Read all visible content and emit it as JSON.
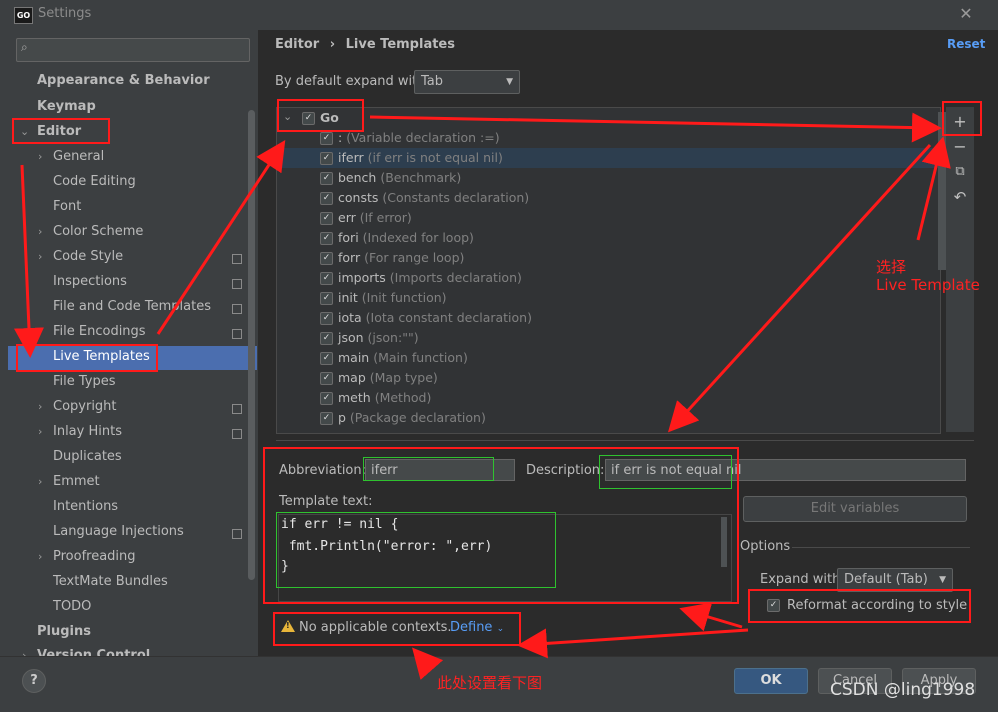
{
  "window": {
    "title": "Settings",
    "logo": "GO"
  },
  "sidebar": {
    "search_placeholder": "",
    "items": [
      {
        "label": "Appearance & Behavior"
      },
      {
        "label": "Keymap"
      },
      {
        "label": "Editor"
      },
      {
        "label": "General"
      },
      {
        "label": "Code Editing"
      },
      {
        "label": "Font"
      },
      {
        "label": "Color Scheme"
      },
      {
        "label": "Code Style"
      },
      {
        "label": "Inspections"
      },
      {
        "label": "File and Code Templates"
      },
      {
        "label": "File Encodings"
      },
      {
        "label": "Live Templates"
      },
      {
        "label": "File Types"
      },
      {
        "label": "Copyright"
      },
      {
        "label": "Inlay Hints"
      },
      {
        "label": "Duplicates"
      },
      {
        "label": "Emmet"
      },
      {
        "label": "Intentions"
      },
      {
        "label": "Language Injections"
      },
      {
        "label": "Proofreading"
      },
      {
        "label": "TextMate Bundles"
      },
      {
        "label": "TODO"
      },
      {
        "label": "Plugins"
      },
      {
        "label": "Version Control"
      }
    ]
  },
  "header": {
    "crumb_parent": "Editor",
    "crumb_sep": "›",
    "crumb_current": "Live Templates",
    "reset": "Reset"
  },
  "expand": {
    "label": "By default expand with",
    "value": "Tab"
  },
  "group": {
    "name": "Go"
  },
  "templates": [
    {
      "name": ":",
      "desc": "(Variable declaration :=)"
    },
    {
      "name": "iferr",
      "desc": "(if err is not equal nil)"
    },
    {
      "name": "bench",
      "desc": "(Benchmark)"
    },
    {
      "name": "consts",
      "desc": "(Constants declaration)"
    },
    {
      "name": "err",
      "desc": "(If error)"
    },
    {
      "name": "fori",
      "desc": "(Indexed for loop)"
    },
    {
      "name": "forr",
      "desc": "(For range loop)"
    },
    {
      "name": "imports",
      "desc": "(Imports declaration)"
    },
    {
      "name": "init",
      "desc": "(Init function)"
    },
    {
      "name": "iota",
      "desc": "(Iota constant declaration)"
    },
    {
      "name": "json",
      "desc": "(json:\"\")"
    },
    {
      "name": "main",
      "desc": "(Main function)"
    },
    {
      "name": "map",
      "desc": "(Map type)"
    },
    {
      "name": "meth",
      "desc": "(Method)"
    },
    {
      "name": "p",
      "desc": "(Package declaration)"
    }
  ],
  "toolbar": {
    "add": "+",
    "remove": "−",
    "copy": "⧉",
    "restore": "↶"
  },
  "editor": {
    "abbr_label": "Abbreviation:",
    "abbr_value": "iferr",
    "desc_label": "Description:",
    "desc_value": "if err is not equal nil",
    "template_label": "Template text:",
    "code": [
      "if err != nil {",
      " fmt.Println(\"error: \",err)",
      "}"
    ],
    "edit_vars": "Edit variables",
    "options_label": "Options",
    "expand_with_label": "Expand with",
    "expand_with_value": "Default (Tab)",
    "reformat_label": "Reformat according to style",
    "warning": "No applicable contexts.",
    "define": "Define"
  },
  "footer": {
    "help": "?",
    "ok": "OK",
    "cancel": "Cancel",
    "apply": "Apply"
  },
  "annotations": {
    "choose_line1": "选择",
    "choose_line2": "Live Template",
    "see_below": "此处设置看下图",
    "watermark": "CSDN @ling1998"
  },
  "colors": {
    "accent": "#4b6eaf",
    "link": "#589df6",
    "annotation": "#ff1a1a",
    "highlight_box": "#2fc22f"
  }
}
